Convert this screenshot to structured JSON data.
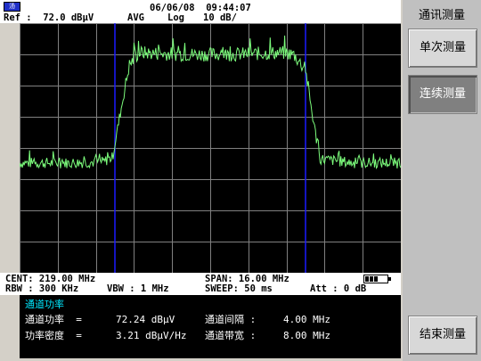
{
  "header": {
    "logo": "汤",
    "datetime": "06/06/08  09:44:07",
    "ref": "Ref :  72.0 dBμV",
    "detector": "AVG",
    "scale_mode": "Log",
    "scale_div": "10 dB/"
  },
  "footer": {
    "cent": "CENT: 219.00 MHz",
    "span": "SPAN: 16.00 MHz",
    "rbw": "RBW : 300 KHz",
    "vbw": "VBW : 1 MHz",
    "sweep": "SWEEP: 50 ms",
    "att": "Att : 0 dB"
  },
  "result_panel": {
    "title": "通道功率",
    "rows": [
      {
        "label": "通道功率  =",
        "value": "72.24 dBμV"
      },
      {
        "label": "功率密度  =",
        "value": "3.21 dBμV/Hz"
      }
    ],
    "right_rows": [
      {
        "label": "通道间隔 :",
        "value": "4.00 MHz"
      },
      {
        "label": "通道带宽 :",
        "value": "8.00 MHz"
      }
    ]
  },
  "softkeys": {
    "title": "通讯测量",
    "buttons": [
      {
        "label": "单次测量",
        "active": false
      },
      {
        "label": "连续测量",
        "active": true
      },
      {
        "label": "结束测量",
        "active": false
      }
    ]
  },
  "chart_data": {
    "type": "line",
    "x_center_mhz": 219.0,
    "x_span_mhz": 16.0,
    "y_ref_dbuv": 72.0,
    "y_div_db": 10,
    "grid": true,
    "grid_divisions": [
      10,
      8
    ],
    "channel_markers_mhz": [
      215.0,
      223.0
    ],
    "series": [
      {
        "color": "#7CFC7C",
        "x_mhz": [
          211,
          213,
          214.5,
          214.9,
          215.2,
          215.6,
          216.0,
          218.0,
          220.0,
          222.0,
          222.5,
          223.0,
          223.3,
          223.6,
          225,
          227
        ],
        "y_dbuv": [
          27.2,
          27.2,
          27.5,
          29.0,
          42.0,
          58.5,
          62.5,
          62.0,
          62.0,
          62.5,
          62.0,
          57.0,
          42.0,
          28.5,
          27.2,
          27.2
        ]
      }
    ],
    "colors": {
      "trace": "#7CFC7C",
      "marker": "#1a1aff",
      "grid": "#808080",
      "background": "#000000"
    }
  }
}
